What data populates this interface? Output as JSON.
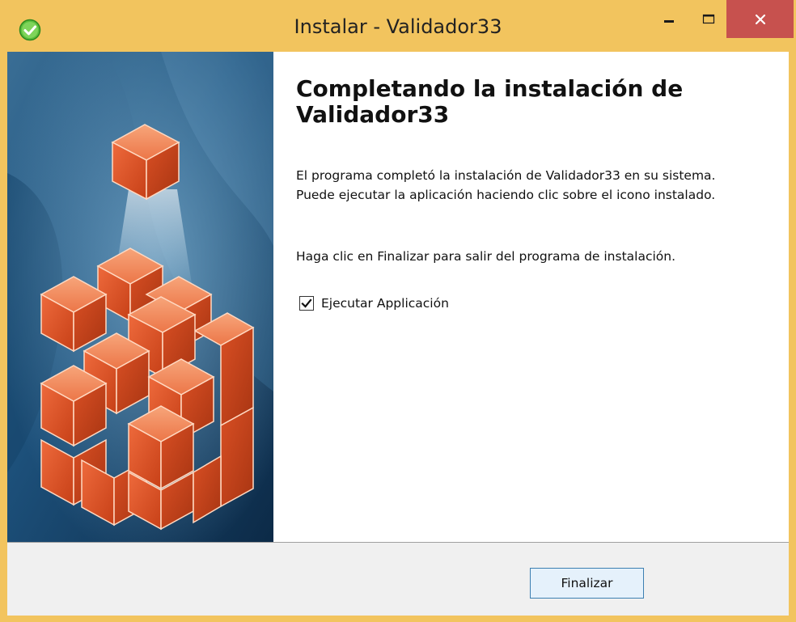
{
  "window": {
    "title": "Instalar - Validador33",
    "icons": {
      "app": "check-circle-icon",
      "minimize": "minimize-icon",
      "maximize": "maximize-icon",
      "close": "close-icon"
    },
    "colors": {
      "titlebar": "#f2c45e",
      "close_button": "#c7514e",
      "banner_dark": "#0f3354",
      "cube_orange": "#e0562c"
    }
  },
  "content": {
    "heading": "Completando la instalación de Validador33",
    "paragraph1": "El programa completó la instalación de Validador33 en su sistema. Puede ejecutar la aplicación haciendo clic sobre el icono instalado.",
    "paragraph2": "Haga clic en Finalizar para salir del programa de instalación.",
    "checkbox": {
      "label": "Ejecutar Applicación",
      "checked": true
    }
  },
  "footer": {
    "finish_label": "Finalizar"
  }
}
